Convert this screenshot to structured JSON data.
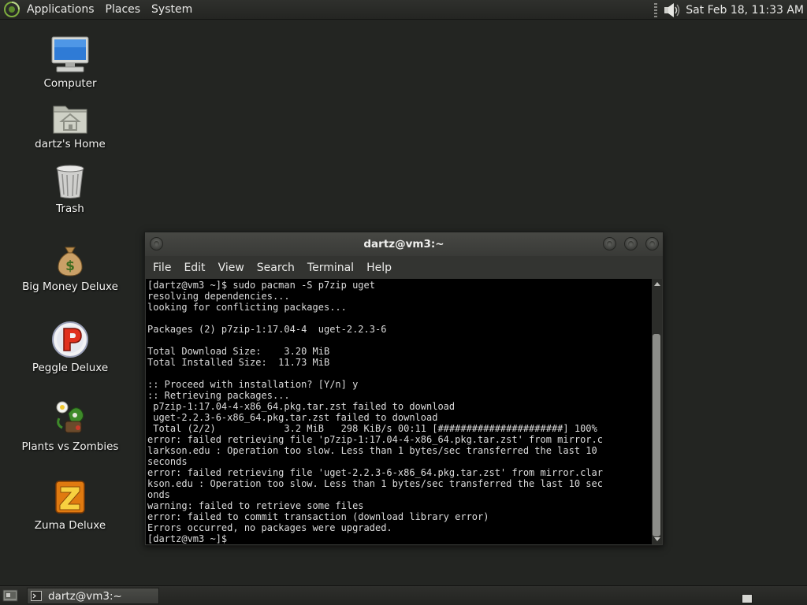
{
  "top_panel": {
    "menus": [
      "Applications",
      "Places",
      "System"
    ],
    "clock": "Sat Feb 18, 11:33 AM"
  },
  "desktop_icons": [
    {
      "label": "Computer",
      "icon": "computer-icon"
    },
    {
      "label": "dartz's Home",
      "icon": "home-folder-icon"
    },
    {
      "label": "Trash",
      "icon": "trash-icon"
    },
    {
      "label": "Big Money Deluxe",
      "icon": "money-bag-icon"
    },
    {
      "label": "Peggle Deluxe",
      "icon": "peggle-icon"
    },
    {
      "label": "Plants vs Zombies",
      "icon": "plants-vs-zombies-icon"
    },
    {
      "label": "Zuma Deluxe",
      "icon": "zuma-icon"
    }
  ],
  "terminal": {
    "title": "dartz@vm3:~",
    "menus": [
      "File",
      "Edit",
      "View",
      "Search",
      "Terminal",
      "Help"
    ],
    "output": "[dartz@vm3 ~]$ sudo pacman -S p7zip uget\nresolving dependencies...\nlooking for conflicting packages...\n\nPackages (2) p7zip-1:17.04-4  uget-2.2.3-6\n\nTotal Download Size:    3.20 MiB\nTotal Installed Size:  11.73 MiB\n\n:: Proceed with installation? [Y/n] y\n:: Retrieving packages...\n p7zip-1:17.04-4-x86_64.pkg.tar.zst failed to download\n uget-2.2.3-6-x86_64.pkg.tar.zst failed to download\n Total (2/2)            3.2 MiB   298 KiB/s 00:11 [######################] 100%\nerror: failed retrieving file 'p7zip-1:17.04-4-x86_64.pkg.tar.zst' from mirror.c\nlarkson.edu : Operation too slow. Less than 1 bytes/sec transferred the last 10\nseconds\nerror: failed retrieving file 'uget-2.2.3-6-x86_64.pkg.tar.zst' from mirror.clar\nkson.edu : Operation too slow. Less than 1 bytes/sec transferred the last 10 sec\nonds\nwarning: failed to retrieve some files\nerror: failed to commit transaction (download library error)\nErrors occurred, no packages were upgraded.\n[dartz@vm3 ~]$ "
  },
  "taskbar": {
    "task_label": "dartz@vm3:~"
  },
  "colors": {
    "desktop_bg": "#232522",
    "panel_bg": "#2a2b28",
    "terminal_bg": "#000000",
    "terminal_fg": "#dcdcdc"
  }
}
